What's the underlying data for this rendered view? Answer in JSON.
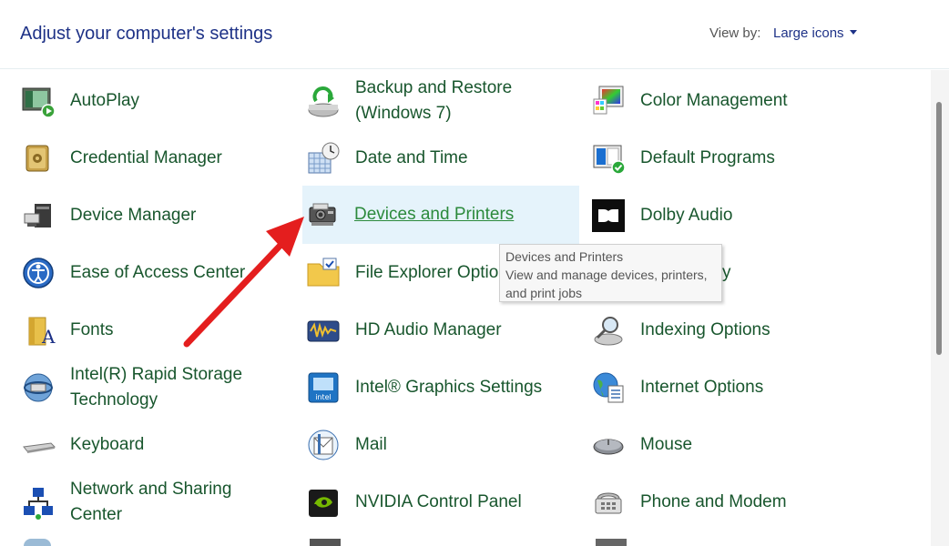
{
  "header": {
    "title": "Adjust your computer's settings",
    "view_by_label": "View by:",
    "view_by_value": "Large icons"
  },
  "items": {
    "autoplay": "AutoPlay",
    "backup_l1": "Backup and Restore",
    "backup_l2": "(Windows 7)",
    "color": "Color Management",
    "credential": "Credential Manager",
    "datetime": "Date and Time",
    "default_programs": "Default Programs",
    "device_manager": "Device Manager",
    "devices_printers": "Devices and Printers",
    "dolby": "Dolby Audio",
    "ease": "Ease of Access Center",
    "file_explorer": "File Explorer Options",
    "fonts": "Fonts",
    "hd_audio": "HD Audio Manager",
    "indexing": "Indexing Options",
    "intel_rst_l1": "Intel(R) Rapid Storage",
    "intel_rst_l2": "Technology",
    "intel_graphics": "Intel® Graphics Settings",
    "internet": "Internet Options",
    "keyboard": "Keyboard",
    "mail": "Mail",
    "mouse": "Mouse",
    "network_l1": "Network and Sharing",
    "network_l2": "Center",
    "nvidia": "NVIDIA Control Panel",
    "phone": "Phone and Modem",
    "partial": "y"
  },
  "tooltip": {
    "title": "Devices and Printers",
    "line1": "View and manage devices, printers,",
    "line2": "and print jobs"
  },
  "colors": {
    "link_green": "#18562d",
    "title_blue": "#1e3287",
    "hover_bg": "#e5f3fb",
    "arrow_red": "#e41e1e"
  },
  "icons": {
    "autoplay": "autoplay-icon",
    "backup": "backup-restore-icon",
    "color": "color-management-icon",
    "credential": "credential-vault-icon",
    "datetime": "calendar-clock-icon",
    "default_programs": "default-programs-icon",
    "device_manager": "device-manager-icon",
    "devices_printers": "printer-camera-icon",
    "dolby": "dolby-logo-icon",
    "ease": "ease-of-access-icon",
    "file_explorer": "folder-check-icon",
    "fonts": "fonts-folder-icon",
    "hd_audio": "audio-wave-icon",
    "indexing": "indexing-magnifier-icon",
    "intel_rst": "intel-storage-icon",
    "intel_graphics": "intel-graphics-icon",
    "internet": "globe-icon",
    "keyboard": "keyboard-icon",
    "mail": "mail-icon",
    "mouse": "mouse-icon",
    "network": "network-icon",
    "nvidia": "nvidia-icon",
    "phone": "phone-modem-icon"
  }
}
